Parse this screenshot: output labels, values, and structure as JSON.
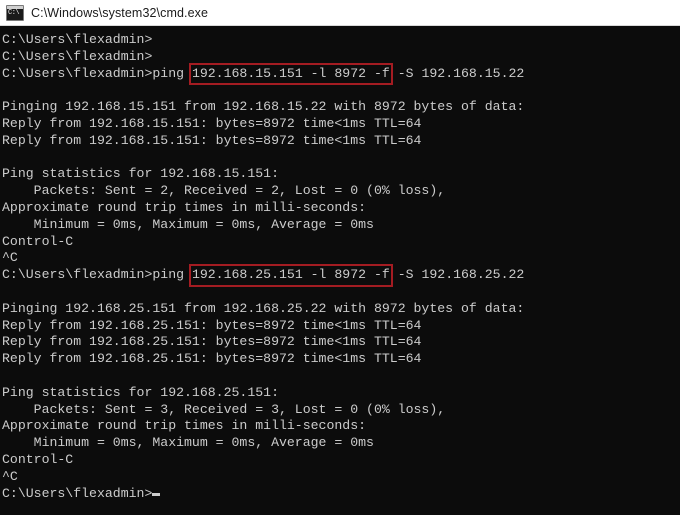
{
  "titlebar": {
    "icon": "cmd-console-icon",
    "icon_glyph": "C:\\",
    "title": "C:\\Windows\\system32\\cmd.exe"
  },
  "console": {
    "prompt": "C:\\Users\\flexadmin>",
    "cursor": "block-cursor",
    "lines": [
      {
        "id": "l01",
        "type": "prompt",
        "text": "C:\\Users\\flexadmin>"
      },
      {
        "id": "l02",
        "type": "prompt",
        "text": "C:\\Users\\flexadmin>"
      },
      {
        "id": "l03",
        "type": "command",
        "prefix": "C:\\Users\\flexadmin>ping ",
        "highlight": "192.168.15.151 -l 8972 -f",
        "suffix": " -S 192.168.15.22"
      },
      {
        "id": "l04",
        "type": "blank",
        "text": ""
      },
      {
        "id": "l05",
        "type": "output",
        "text": "Pinging 192.168.15.151 from 192.168.15.22 with 8972 bytes of data:"
      },
      {
        "id": "l06",
        "type": "output",
        "text": "Reply from 192.168.15.151: bytes=8972 time<1ms TTL=64"
      },
      {
        "id": "l07",
        "type": "output",
        "text": "Reply from 192.168.15.151: bytes=8972 time<1ms TTL=64"
      },
      {
        "id": "l08",
        "type": "blank",
        "text": ""
      },
      {
        "id": "l09",
        "type": "output",
        "text": "Ping statistics for 192.168.15.151:"
      },
      {
        "id": "l10",
        "type": "output",
        "text": "    Packets: Sent = 2, Received = 2, Lost = 0 (0% loss),"
      },
      {
        "id": "l11",
        "type": "output",
        "text": "Approximate round trip times in milli-seconds:"
      },
      {
        "id": "l12",
        "type": "output",
        "text": "    Minimum = 0ms, Maximum = 0ms, Average = 0ms"
      },
      {
        "id": "l13",
        "type": "output",
        "text": "Control-C"
      },
      {
        "id": "l14",
        "type": "output",
        "text": "^C"
      },
      {
        "id": "l15",
        "type": "command",
        "prefix": "C:\\Users\\flexadmin>ping ",
        "highlight": "192.168.25.151 -l 8972 -f",
        "suffix": " -S 192.168.25.22"
      },
      {
        "id": "l16",
        "type": "blank",
        "text": ""
      },
      {
        "id": "l17",
        "type": "output",
        "text": "Pinging 192.168.25.151 from 192.168.25.22 with 8972 bytes of data:"
      },
      {
        "id": "l18",
        "type": "output",
        "text": "Reply from 192.168.25.151: bytes=8972 time<1ms TTL=64"
      },
      {
        "id": "l19",
        "type": "output",
        "text": "Reply from 192.168.25.151: bytes=8972 time<1ms TTL=64"
      },
      {
        "id": "l20",
        "type": "output",
        "text": "Reply from 192.168.25.151: bytes=8972 time<1ms TTL=64"
      },
      {
        "id": "l21",
        "type": "blank",
        "text": ""
      },
      {
        "id": "l22",
        "type": "output",
        "text": "Ping statistics for 192.168.25.151:"
      },
      {
        "id": "l23",
        "type": "output",
        "text": "    Packets: Sent = 3, Received = 3, Lost = 0 (0% loss),"
      },
      {
        "id": "l24",
        "type": "output",
        "text": "Approximate round trip times in milli-seconds:"
      },
      {
        "id": "l25",
        "type": "output",
        "text": "    Minimum = 0ms, Maximum = 0ms, Average = 0ms"
      },
      {
        "id": "l26",
        "type": "output",
        "text": "Control-C"
      },
      {
        "id": "l27",
        "type": "output",
        "text": "^C"
      },
      {
        "id": "l28",
        "type": "prompt-cursor",
        "text": "C:\\Users\\flexadmin>"
      }
    ]
  },
  "colors": {
    "console_background": "#0c0c0c",
    "console_text": "#cccccc",
    "titlebar_background": "#ffffff",
    "titlebar_text": "#1b1b1b",
    "annotation_box": "#a41c22"
  }
}
